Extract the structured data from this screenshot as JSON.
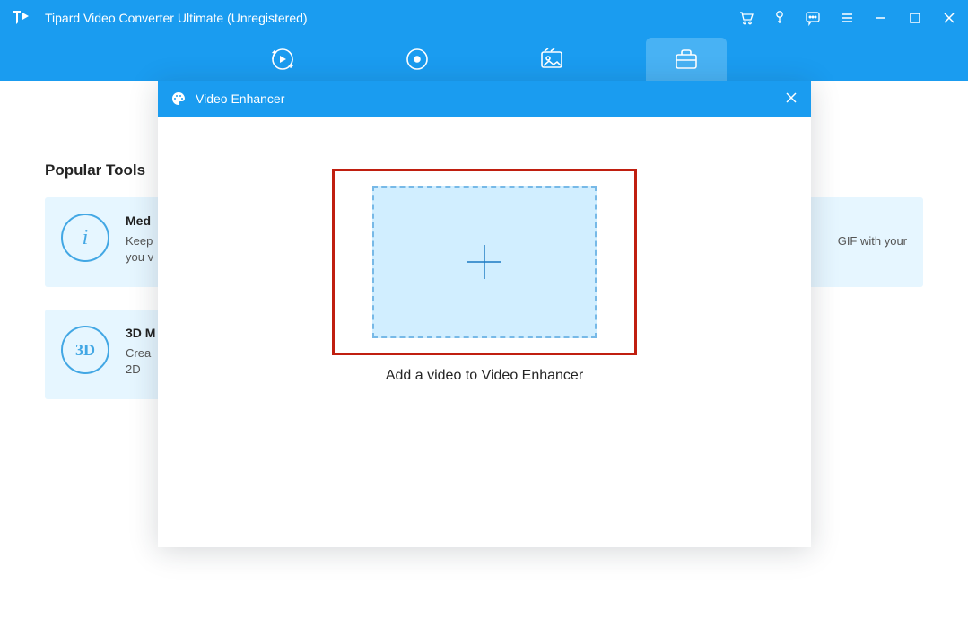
{
  "window": {
    "title": "Tipard Video Converter Ultimate (Unregistered)"
  },
  "section": {
    "title": "Popular Tools"
  },
  "cards": {
    "left1_title": "Med",
    "left1_desc1": "Keep",
    "left1_desc2": "you v",
    "left2_title": "3D M",
    "left2_desc1": "Crea",
    "left2_desc2": "2D",
    "right1_desc": "GIF with your"
  },
  "dialog": {
    "title": "Video Enhancer",
    "caption": "Add a video to Video Enhancer"
  },
  "icons": {
    "threeD": "3D",
    "i": "i"
  }
}
